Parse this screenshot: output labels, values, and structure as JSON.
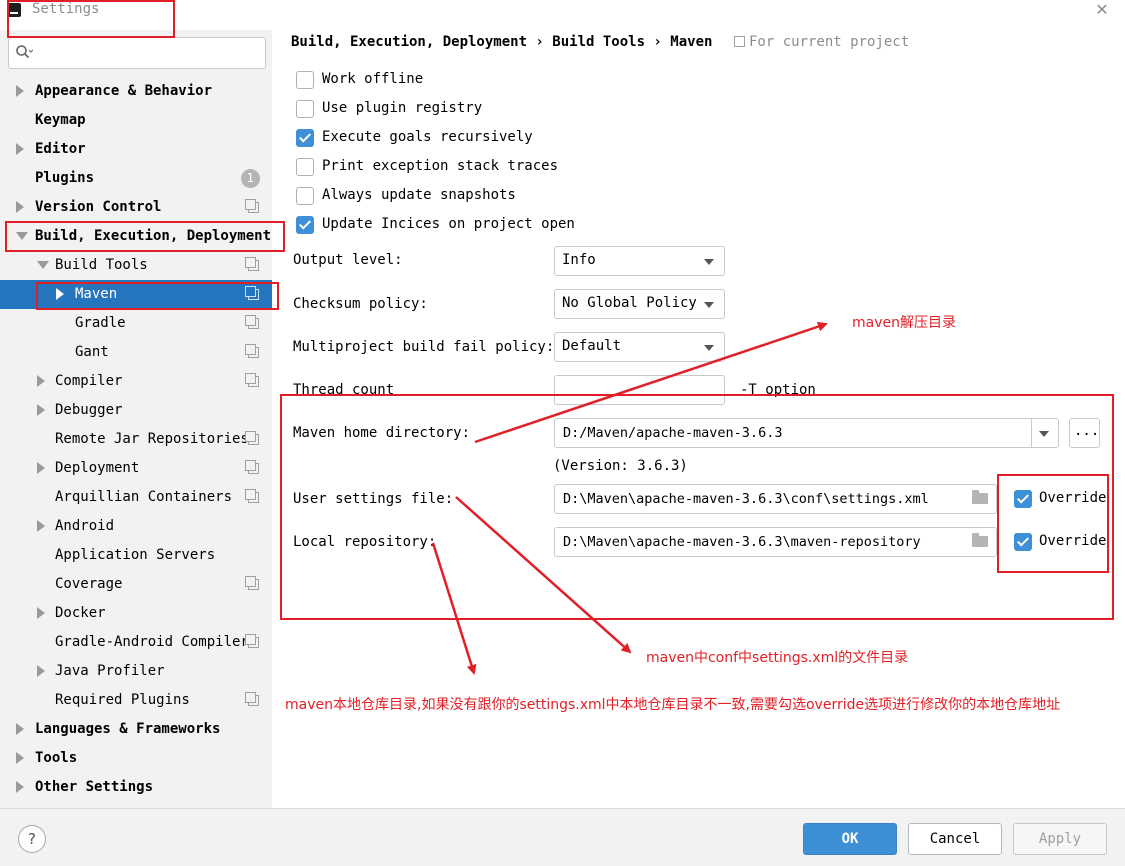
{
  "window": {
    "title": "Settings",
    "close_glyph": "✕"
  },
  "search": {
    "placeholder": "",
    "icon": "search-icon"
  },
  "sidebar": {
    "items": [
      {
        "label": "Appearance & Behavior",
        "level": 0,
        "arrow": "right",
        "bold": true,
        "project": false
      },
      {
        "label": "Keymap",
        "level": 0,
        "arrow": "none",
        "bold": true,
        "project": false
      },
      {
        "label": "Editor",
        "level": 0,
        "arrow": "right",
        "bold": true,
        "project": false
      },
      {
        "label": "Plugins",
        "level": 0,
        "arrow": "none",
        "bold": true,
        "project": false,
        "badge": "1"
      },
      {
        "label": "Version Control",
        "level": 0,
        "arrow": "right",
        "bold": true,
        "project": true
      },
      {
        "label": "Build, Execution, Deployment",
        "level": 0,
        "arrow": "down",
        "bold": true,
        "project": false
      },
      {
        "label": "Build Tools",
        "level": 1,
        "arrow": "down",
        "bold": false,
        "project": true
      },
      {
        "label": "Maven",
        "level": 2,
        "arrow": "right",
        "bold": false,
        "project": true,
        "selected": true
      },
      {
        "label": "Gradle",
        "level": 2,
        "arrow": "none",
        "bold": false,
        "project": true
      },
      {
        "label": "Gant",
        "level": 2,
        "arrow": "none",
        "bold": false,
        "project": true
      },
      {
        "label": "Compiler",
        "level": 1,
        "arrow": "right",
        "bold": false,
        "project": true
      },
      {
        "label": "Debugger",
        "level": 1,
        "arrow": "right",
        "bold": false,
        "project": false
      },
      {
        "label": "Remote Jar Repositories",
        "level": 1,
        "arrow": "none",
        "bold": false,
        "project": true
      },
      {
        "label": "Deployment",
        "level": 1,
        "arrow": "right",
        "bold": false,
        "project": true
      },
      {
        "label": "Arquillian Containers",
        "level": 1,
        "arrow": "none",
        "bold": false,
        "project": true
      },
      {
        "label": "Android",
        "level": 1,
        "arrow": "right",
        "bold": false,
        "project": false
      },
      {
        "label": "Application Servers",
        "level": 1,
        "arrow": "none",
        "bold": false,
        "project": false
      },
      {
        "label": "Coverage",
        "level": 1,
        "arrow": "none",
        "bold": false,
        "project": true
      },
      {
        "label": "Docker",
        "level": 1,
        "arrow": "right",
        "bold": false,
        "project": false
      },
      {
        "label": "Gradle-Android Compiler",
        "level": 1,
        "arrow": "none",
        "bold": false,
        "project": true
      },
      {
        "label": "Java Profiler",
        "level": 1,
        "arrow": "right",
        "bold": false,
        "project": false
      },
      {
        "label": "Required Plugins",
        "level": 1,
        "arrow": "none",
        "bold": false,
        "project": true
      },
      {
        "label": "Languages & Frameworks",
        "level": 0,
        "arrow": "right",
        "bold": true,
        "project": false
      },
      {
        "label": "Tools",
        "level": 0,
        "arrow": "right",
        "bold": true,
        "project": false
      },
      {
        "label": "Other Settings",
        "level": 0,
        "arrow": "right",
        "bold": true,
        "project": false
      }
    ]
  },
  "header": {
    "breadcrumb": "Build, Execution, Deployment › Build Tools › Maven",
    "scope": "For current project"
  },
  "checkboxes": [
    {
      "label": "Work offline",
      "checked": false
    },
    {
      "label": "Use plugin registry",
      "checked": false
    },
    {
      "label": "Execute goals recursively",
      "checked": true
    },
    {
      "label": "Print exception stack traces",
      "checked": false
    },
    {
      "label": "Always update snapshots",
      "checked": false
    },
    {
      "label": "Update Incices on project open",
      "checked": true
    }
  ],
  "fields": {
    "output_level": {
      "label": "Output level:",
      "value": "Info"
    },
    "checksum_policy": {
      "label": "Checksum policy:",
      "value": "No Global Policy"
    },
    "multiproject_fail_policy": {
      "label": "Multiproject build fail policy:",
      "value": "Default"
    },
    "thread_count": {
      "label": "Thread count",
      "value": "",
      "suffix": "-T option"
    },
    "maven_home": {
      "label": "Maven home directory:",
      "value": "D:/Maven/apache-maven-3.6.3",
      "browse": "...",
      "version": "(Version: 3.6.3)"
    },
    "user_settings": {
      "label": "User settings file:",
      "value": "D:\\Maven\\apache-maven-3.6.3\\conf\\settings.xml",
      "override_label": "Override",
      "override": true
    },
    "local_repository": {
      "label": "Local repository:",
      "value": "D:\\Maven\\apache-maven-3.6.3\\maven-repository",
      "override_label": "Override",
      "override": true
    }
  },
  "buttons": {
    "ok": "OK",
    "cancel": "Cancel",
    "apply": "Apply",
    "help": "?"
  },
  "annotations": {
    "maven_home_note": "maven解压目录",
    "settings_note": "maven中conf中settings.xml的文件目录",
    "repository_note": "maven本地仓库目录,如果没有跟你的settings.xml中本地仓库目录不一致,需要勾选override选项进行修改你的本地仓库地址"
  },
  "colors": {
    "selection": "#2675bf",
    "accent": "#3d8fd6",
    "annotation": "#e21f26",
    "sidebar_bg": "#f2f2f2"
  }
}
